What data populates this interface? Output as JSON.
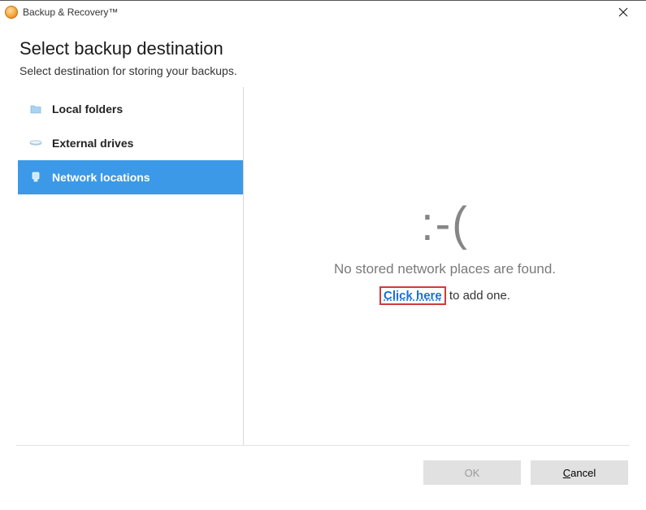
{
  "titlebar": {
    "app_name": "Backup & Recovery™"
  },
  "header": {
    "title": "Select backup destination",
    "subtitle": "Select destination for storing your backups."
  },
  "sidebar": {
    "items": [
      {
        "label": "Local folders",
        "icon": "folder-icon",
        "selected": false
      },
      {
        "label": "External drives",
        "icon": "drive-icon",
        "selected": false
      },
      {
        "label": "Network locations",
        "icon": "network-icon",
        "selected": true
      }
    ]
  },
  "content": {
    "emoticon": ":-(",
    "empty_message": "No stored network places are found.",
    "action_link": "Click here",
    "action_suffix": " to add one."
  },
  "footer": {
    "ok_label": "OK",
    "ok_enabled": false,
    "cancel_prefix": "C",
    "cancel_rest": "ancel"
  },
  "colors": {
    "selection": "#3b99e8",
    "link": "#1a6fd6",
    "highlight_box": "#d23a3a"
  }
}
